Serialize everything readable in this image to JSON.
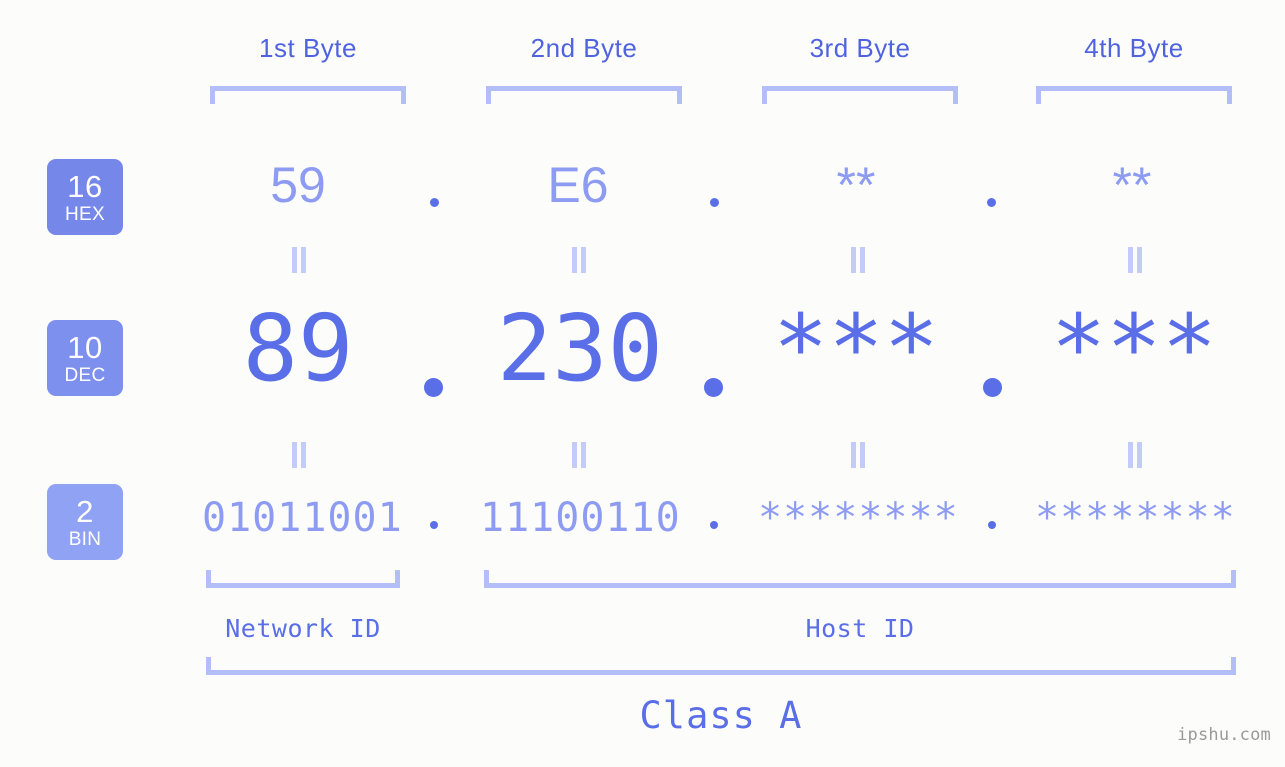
{
  "page": {
    "background_color": "#fcfdfa",
    "accent_color": "#5a6ee8",
    "accent_light_color": "#8d9cf2",
    "bracket_color": "#b3bdf7",
    "watermark": "ipshu.com"
  },
  "byte_headers": [
    {
      "label": "1st Byte"
    },
    {
      "label": "2nd Byte"
    },
    {
      "label": "3rd Byte"
    },
    {
      "label": "4th Byte"
    }
  ],
  "bases": [
    {
      "number": "16",
      "name": "HEX",
      "color": "#7588ea"
    },
    {
      "number": "10",
      "name": "DEC",
      "color": "#7e90ed"
    },
    {
      "number": "2",
      "name": "BIN",
      "color": "#90a2f4"
    }
  ],
  "rows": {
    "hex": {
      "base_number": "16",
      "base_name": "HEX",
      "values": [
        "59",
        "E6",
        "**",
        "**"
      ],
      "separator": "."
    },
    "dec": {
      "base_number": "10",
      "base_name": "DEC",
      "values": [
        "89",
        "230",
        "***",
        "***"
      ],
      "separator": "."
    },
    "bin": {
      "base_number": "2",
      "base_name": "BIN",
      "values": [
        "01011001",
        "11100110",
        "********",
        "********"
      ],
      "separator": "."
    }
  },
  "connectors": {
    "symbol": "="
  },
  "segments": {
    "network_id": "Network ID",
    "host_id": "Host ID",
    "class": "Class A"
  }
}
